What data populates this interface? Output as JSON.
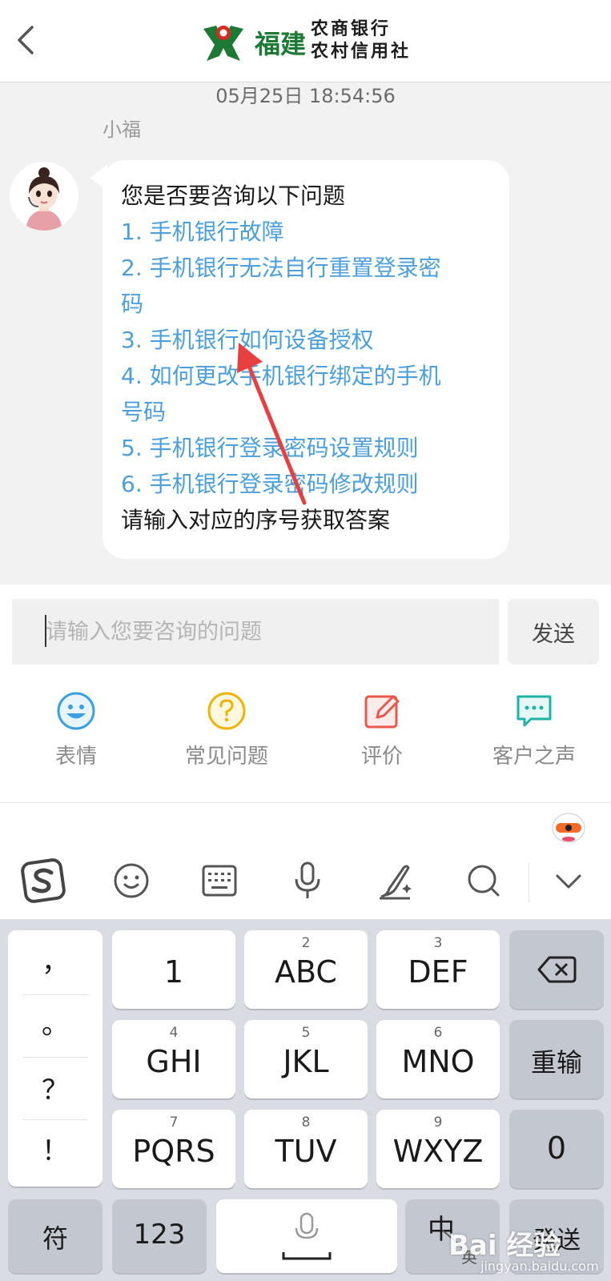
{
  "header": {
    "logo_main": "福建",
    "logo_line1": "农商银行",
    "logo_line2": "农村信用社"
  },
  "chat": {
    "timestamp": "05月25日 18:54:56",
    "sender": "小福",
    "message_lines": [
      {
        "text": "您是否要咨询以下问题",
        "link": false
      },
      {
        "text": "1. 手机银行故障",
        "link": true
      },
      {
        "text": "2. 手机银行无法自行重置登录密",
        "link": true
      },
      {
        "text": "码",
        "link": true
      },
      {
        "text": "3. 手机银行如何设备授权",
        "link": true
      },
      {
        "text": "4. 如何更改手机银行绑定的手机",
        "link": true
      },
      {
        "text": "号码",
        "link": true
      },
      {
        "text": "5. 手机银行登录密码设置规则",
        "link": true
      },
      {
        "text": "6. 手机银行登录密码修改规则",
        "link": true
      },
      {
        "text": "请输入对应的序号获取答案",
        "link": false
      }
    ]
  },
  "input": {
    "placeholder": "请输入您要咨询的问题",
    "value": "",
    "send_label": "发送"
  },
  "actions": [
    {
      "label": "表情",
      "icon": "smiley-icon",
      "color": "#3aa0e6"
    },
    {
      "label": "常见问题",
      "icon": "question-circle-icon",
      "color": "#f0b400"
    },
    {
      "label": "评价",
      "icon": "edit-icon",
      "color": "#e8584b"
    },
    {
      "label": "客户之声",
      "icon": "chat-bubble-icon",
      "color": "#1fb3a8"
    }
  ],
  "keyboard": {
    "toolbar": [
      "sogou-logo-icon",
      "emoji-icon",
      "keyboard-icon",
      "microphone-icon",
      "handwriting-icon",
      "search-icon",
      "collapse-icon"
    ],
    "punctuation": [
      "，",
      "。",
      "？",
      "！"
    ],
    "keys": [
      {
        "num": "",
        "main": "1"
      },
      {
        "num": "2",
        "main": "ABC"
      },
      {
        "num": "3",
        "main": "DEF"
      },
      {
        "num": "4",
        "main": "GHI"
      },
      {
        "num": "5",
        "main": "JKL"
      },
      {
        "num": "6",
        "main": "MNO"
      },
      {
        "num": "7",
        "main": "PQRS"
      },
      {
        "num": "8",
        "main": "TUV"
      },
      {
        "num": "9",
        "main": "WXYZ"
      }
    ],
    "reinput": "重输",
    "zero": "0",
    "symbols": "符",
    "numbers": "123",
    "lang_main": "中",
    "lang_sub": "英",
    "enter": "発送"
  },
  "watermark": {
    "text": "Bai 经验",
    "url": "jingyan.baidu.com"
  },
  "colors": {
    "brand_green": "#1c7a35",
    "link_blue": "#4a9fdc",
    "arrow_red": "#e84040"
  }
}
